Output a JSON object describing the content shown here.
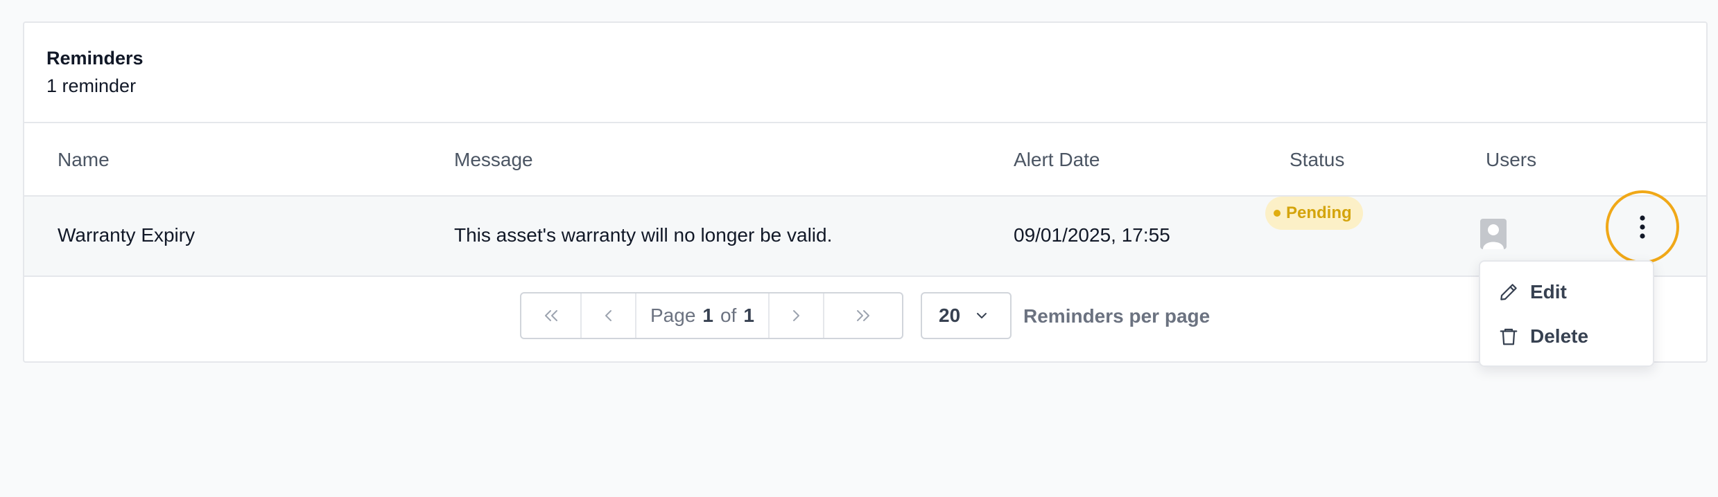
{
  "card": {
    "title": "Reminders",
    "subtitle": "1 reminder"
  },
  "table": {
    "columns": [
      "Name",
      "Message",
      "Alert Date",
      "Status",
      "Users"
    ],
    "rows": [
      {
        "name": "Warranty Expiry",
        "message": "This asset's warranty will no longer be valid.",
        "alert_date": "09/01/2025, 17:55",
        "status": "Pending"
      }
    ]
  },
  "row_menu": {
    "items": [
      {
        "label": "Edit",
        "icon": "pencil-icon"
      },
      {
        "label": "Delete",
        "icon": "trash-icon"
      }
    ]
  },
  "pagination": {
    "page_label": "Page",
    "current_page": "1",
    "of_label": "of",
    "total_pages": "1",
    "per_page_value": "20",
    "per_page_label": "Reminders per page"
  },
  "colors": {
    "accent_ring": "#f0a818",
    "status_pending_bg": "#fcf0c7",
    "status_pending_text": "#d4a40c"
  }
}
